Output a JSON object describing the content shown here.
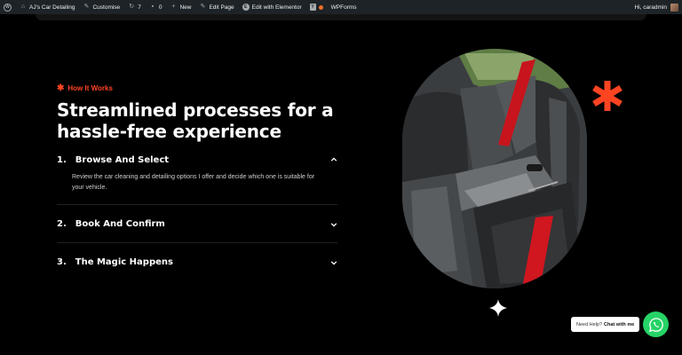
{
  "adminbar": {
    "site_name": "AJ's Car Detailing",
    "customise": "Customise",
    "updates_count": "7",
    "comments_count": "0",
    "new_label": "New",
    "edit_page": "Edit Page",
    "edit_elementor": "Edit with Elementor",
    "wpforms": "WPForms",
    "greeting": "Hi, caradmin"
  },
  "section": {
    "eyebrow": "How It Works",
    "heading": "Streamlined processes for a hassle-free experience"
  },
  "accordion": [
    {
      "number": "1.",
      "title": "Browse And Select",
      "body": "Review the car cleaning and detailing options I offer and decide which one is suitable for your vehicle.",
      "open": true
    },
    {
      "number": "2.",
      "title": "Book And Confirm",
      "open": false
    },
    {
      "number": "3.",
      "title": "The Magic Happens",
      "open": false
    }
  ],
  "chat": {
    "prompt": "Need Help?",
    "cta": "Chat with me"
  },
  "colors": {
    "accent": "#ff4422",
    "whatsapp": "#25d366",
    "adminbar": "#1d2327"
  }
}
